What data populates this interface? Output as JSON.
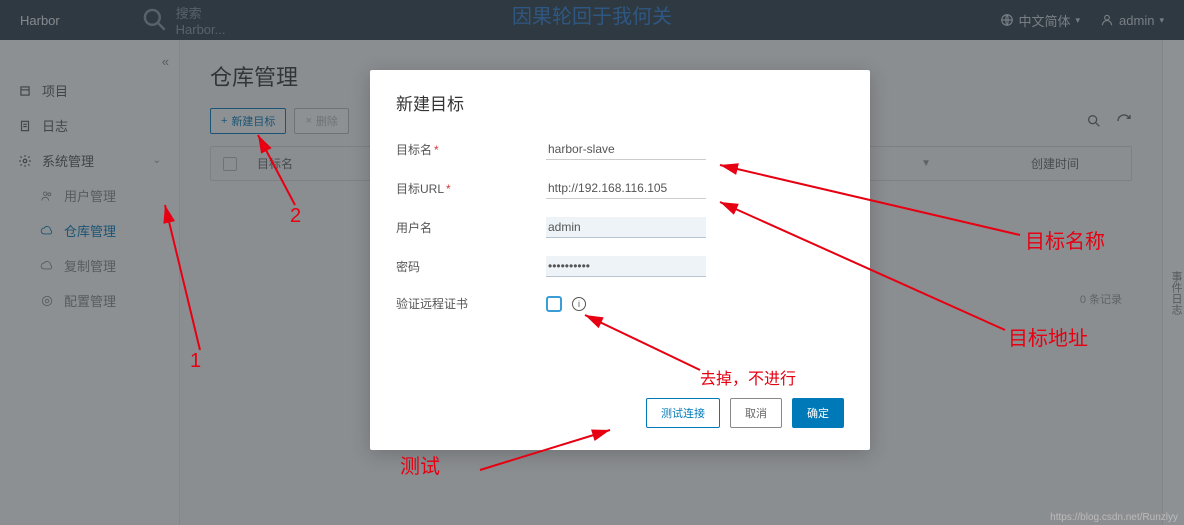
{
  "banner": "因果轮回于我何关",
  "header": {
    "brand": "Harbor",
    "search_placeholder": "搜索 Harbor...",
    "lang": "中文简体",
    "user": "admin"
  },
  "sidebar": {
    "collapse_glyph": "«",
    "items": [
      {
        "label": "项目"
      },
      {
        "label": "日志"
      },
      {
        "label": "系统管理",
        "expandable": true
      },
      {
        "label": "用户管理",
        "sub": true
      },
      {
        "label": "仓库管理",
        "sub": true,
        "active": true
      },
      {
        "label": "复制管理",
        "sub": true
      },
      {
        "label": "配置管理",
        "sub": true
      }
    ]
  },
  "main": {
    "title": "仓库管理",
    "btn_new": "新建目标",
    "btn_del": "删除",
    "table": {
      "col1": "目标名",
      "col_last": "创建时间"
    },
    "footer": "0 条记录"
  },
  "right_strip": "事件日志",
  "modal": {
    "title": "新建目标",
    "fields": {
      "name_label": "目标名",
      "name_value": "harbor-slave",
      "url_label": "目标URL",
      "url_value": "http://192.168.116.105",
      "user_label": "用户名",
      "user_value": "admin",
      "pw_label": "密码",
      "pw_value": "••••••••••",
      "verify_label": "验证远程证书"
    },
    "btn_test": "测试连接",
    "btn_cancel": "取消",
    "btn_ok": "确定"
  },
  "annotations": {
    "num1": "1",
    "num2": "2",
    "target_name": "目标名称",
    "target_addr": "目标地址",
    "remove": "去掉，不进行",
    "test": "测试"
  },
  "watermark": "https://blog.csdn.net/Runzlyy"
}
